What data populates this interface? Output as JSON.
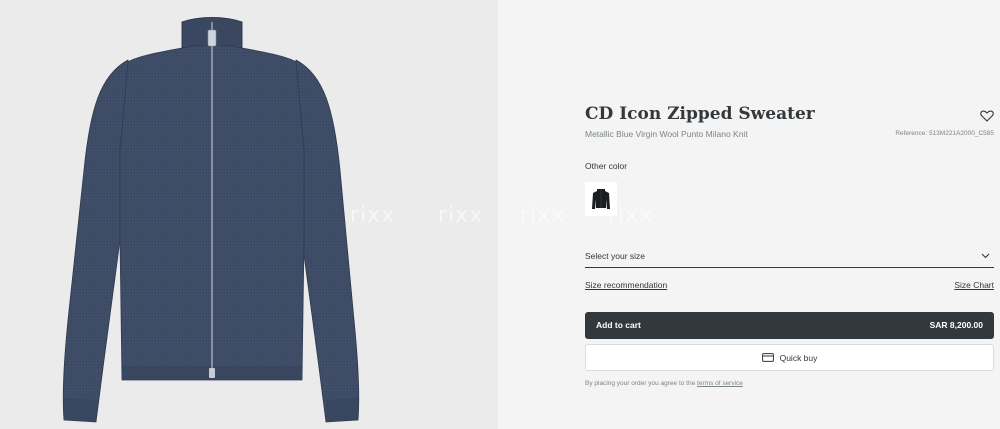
{
  "product": {
    "title": "CD Icon Zipped Sweater",
    "subtitle": "Metallic Blue Virgin Wool Punto Milano Knit",
    "reference": "Reference: 513M221A2000_C585",
    "image_alt": "zipped sweater product photo",
    "sweater_color": "#3e4c66"
  },
  "watermark": {
    "text": "rixx"
  },
  "other_color": {
    "label": "Other color",
    "swatch_color": "#1b1c1e"
  },
  "size": {
    "select_label": "Select your size",
    "recommendation_link": "Size recommendation",
    "chart_link": "Size Chart"
  },
  "cart": {
    "add_label": "Add to cart",
    "price": "SAR 8,200.00",
    "quick_buy_label": "Quick buy"
  },
  "terms": {
    "prefix": "By placing your order you agree to the",
    "link": "terms of service"
  },
  "icons": {
    "wishlist": "heart-icon",
    "dropdown": "chevron-down-icon",
    "quick_buy": "card-icon"
  }
}
